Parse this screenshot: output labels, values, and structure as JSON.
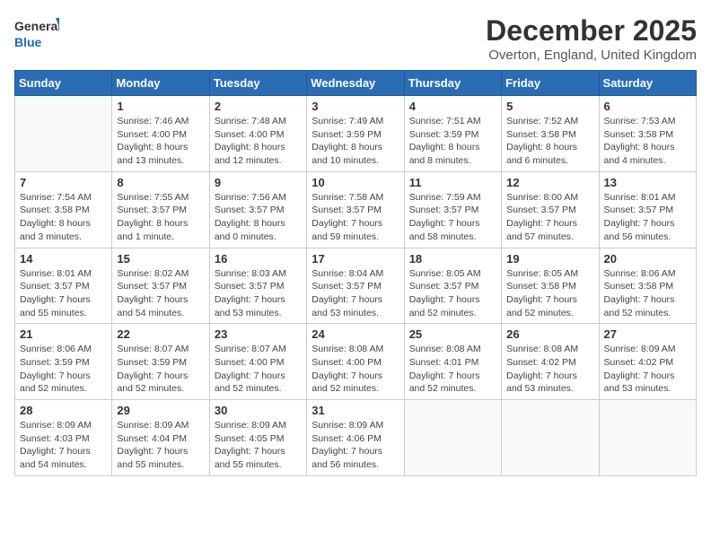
{
  "logo": {
    "line1": "General",
    "line2": "Blue"
  },
  "title": "December 2025",
  "subtitle": "Overton, England, United Kingdom",
  "weekdays": [
    "Sunday",
    "Monday",
    "Tuesday",
    "Wednesday",
    "Thursday",
    "Friday",
    "Saturday"
  ],
  "weeks": [
    [
      {
        "day": "",
        "detail": ""
      },
      {
        "day": "1",
        "detail": "Sunrise: 7:46 AM\nSunset: 4:00 PM\nDaylight: 8 hours\nand 13 minutes."
      },
      {
        "day": "2",
        "detail": "Sunrise: 7:48 AM\nSunset: 4:00 PM\nDaylight: 8 hours\nand 12 minutes."
      },
      {
        "day": "3",
        "detail": "Sunrise: 7:49 AM\nSunset: 3:59 PM\nDaylight: 8 hours\nand 10 minutes."
      },
      {
        "day": "4",
        "detail": "Sunrise: 7:51 AM\nSunset: 3:59 PM\nDaylight: 8 hours\nand 8 minutes."
      },
      {
        "day": "5",
        "detail": "Sunrise: 7:52 AM\nSunset: 3:58 PM\nDaylight: 8 hours\nand 6 minutes."
      },
      {
        "day": "6",
        "detail": "Sunrise: 7:53 AM\nSunset: 3:58 PM\nDaylight: 8 hours\nand 4 minutes."
      }
    ],
    [
      {
        "day": "7",
        "detail": "Sunrise: 7:54 AM\nSunset: 3:58 PM\nDaylight: 8 hours\nand 3 minutes."
      },
      {
        "day": "8",
        "detail": "Sunrise: 7:55 AM\nSunset: 3:57 PM\nDaylight: 8 hours\nand 1 minute."
      },
      {
        "day": "9",
        "detail": "Sunrise: 7:56 AM\nSunset: 3:57 PM\nDaylight: 8 hours\nand 0 minutes."
      },
      {
        "day": "10",
        "detail": "Sunrise: 7:58 AM\nSunset: 3:57 PM\nDaylight: 7 hours\nand 59 minutes."
      },
      {
        "day": "11",
        "detail": "Sunrise: 7:59 AM\nSunset: 3:57 PM\nDaylight: 7 hours\nand 58 minutes."
      },
      {
        "day": "12",
        "detail": "Sunrise: 8:00 AM\nSunset: 3:57 PM\nDaylight: 7 hours\nand 57 minutes."
      },
      {
        "day": "13",
        "detail": "Sunrise: 8:01 AM\nSunset: 3:57 PM\nDaylight: 7 hours\nand 56 minutes."
      }
    ],
    [
      {
        "day": "14",
        "detail": "Sunrise: 8:01 AM\nSunset: 3:57 PM\nDaylight: 7 hours\nand 55 minutes."
      },
      {
        "day": "15",
        "detail": "Sunrise: 8:02 AM\nSunset: 3:57 PM\nDaylight: 7 hours\nand 54 minutes."
      },
      {
        "day": "16",
        "detail": "Sunrise: 8:03 AM\nSunset: 3:57 PM\nDaylight: 7 hours\nand 53 minutes."
      },
      {
        "day": "17",
        "detail": "Sunrise: 8:04 AM\nSunset: 3:57 PM\nDaylight: 7 hours\nand 53 minutes."
      },
      {
        "day": "18",
        "detail": "Sunrise: 8:05 AM\nSunset: 3:57 PM\nDaylight: 7 hours\nand 52 minutes."
      },
      {
        "day": "19",
        "detail": "Sunrise: 8:05 AM\nSunset: 3:58 PM\nDaylight: 7 hours\nand 52 minutes."
      },
      {
        "day": "20",
        "detail": "Sunrise: 8:06 AM\nSunset: 3:58 PM\nDaylight: 7 hours\nand 52 minutes."
      }
    ],
    [
      {
        "day": "21",
        "detail": "Sunrise: 8:06 AM\nSunset: 3:59 PM\nDaylight: 7 hours\nand 52 minutes."
      },
      {
        "day": "22",
        "detail": "Sunrise: 8:07 AM\nSunset: 3:59 PM\nDaylight: 7 hours\nand 52 minutes."
      },
      {
        "day": "23",
        "detail": "Sunrise: 8:07 AM\nSunset: 4:00 PM\nDaylight: 7 hours\nand 52 minutes."
      },
      {
        "day": "24",
        "detail": "Sunrise: 8:08 AM\nSunset: 4:00 PM\nDaylight: 7 hours\nand 52 minutes."
      },
      {
        "day": "25",
        "detail": "Sunrise: 8:08 AM\nSunset: 4:01 PM\nDaylight: 7 hours\nand 52 minutes."
      },
      {
        "day": "26",
        "detail": "Sunrise: 8:08 AM\nSunset: 4:02 PM\nDaylight: 7 hours\nand 53 minutes."
      },
      {
        "day": "27",
        "detail": "Sunrise: 8:09 AM\nSunset: 4:02 PM\nDaylight: 7 hours\nand 53 minutes."
      }
    ],
    [
      {
        "day": "28",
        "detail": "Sunrise: 8:09 AM\nSunset: 4:03 PM\nDaylight: 7 hours\nand 54 minutes."
      },
      {
        "day": "29",
        "detail": "Sunrise: 8:09 AM\nSunset: 4:04 PM\nDaylight: 7 hours\nand 55 minutes."
      },
      {
        "day": "30",
        "detail": "Sunrise: 8:09 AM\nSunset: 4:05 PM\nDaylight: 7 hours\nand 55 minutes."
      },
      {
        "day": "31",
        "detail": "Sunrise: 8:09 AM\nSunset: 4:06 PM\nDaylight: 7 hours\nand 56 minutes."
      },
      {
        "day": "",
        "detail": ""
      },
      {
        "day": "",
        "detail": ""
      },
      {
        "day": "",
        "detail": ""
      }
    ]
  ]
}
